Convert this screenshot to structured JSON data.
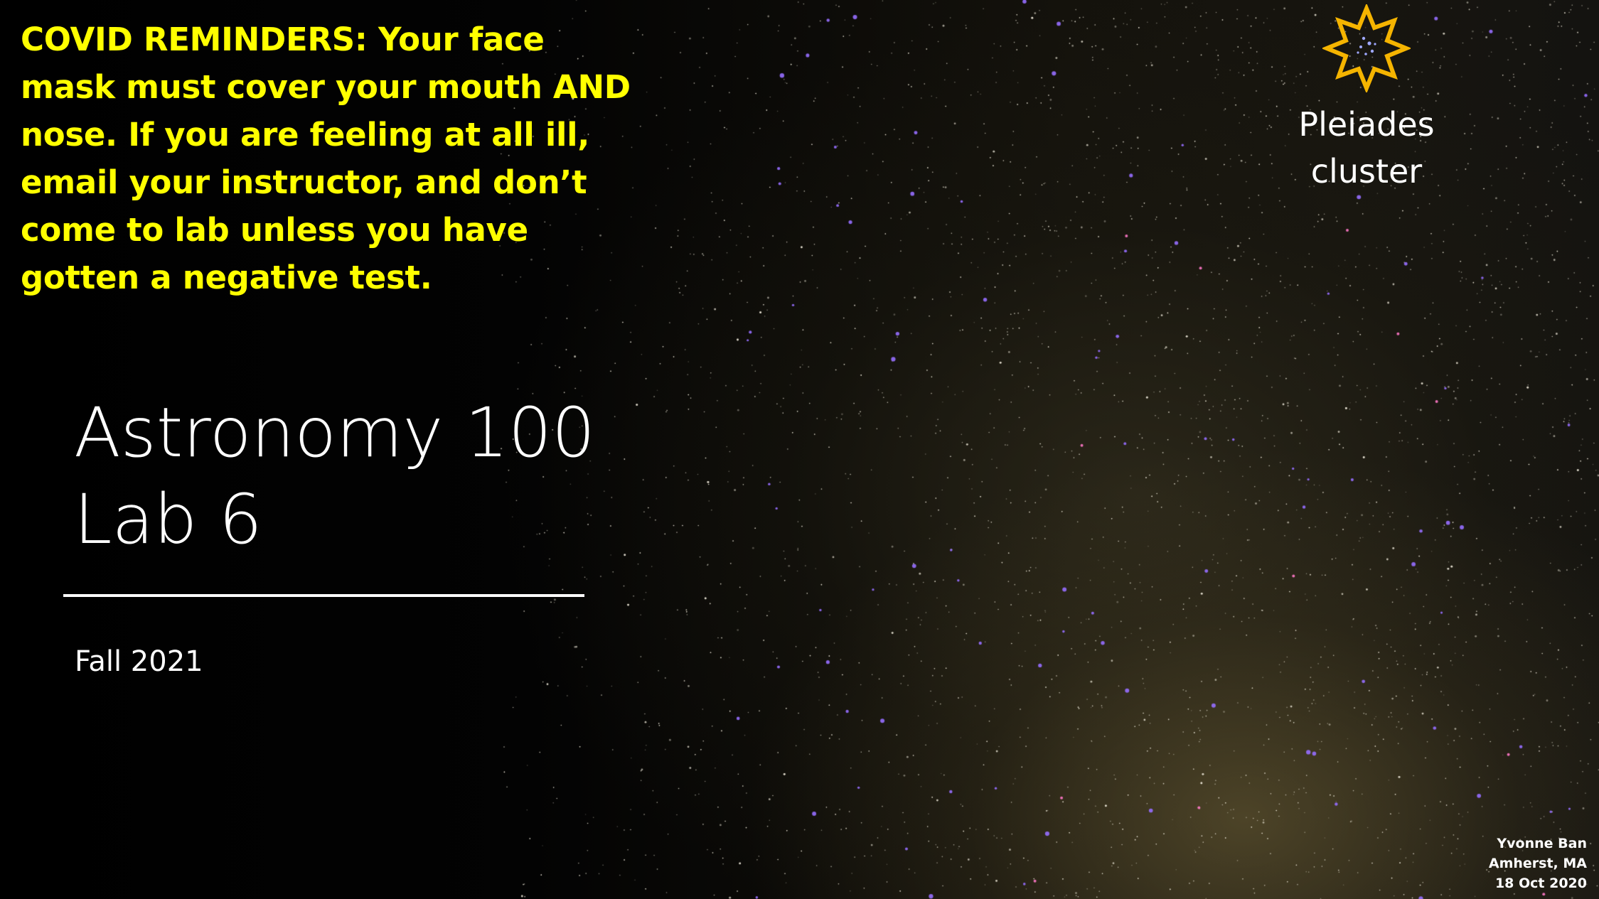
{
  "slide": {
    "covid_reminder": "COVID REMINDERS: Your face mask must cover your mouth AND nose. If you are feeling at all ill, email your instructor, and don’t come to lab unless you have gotten a negative test.",
    "title_line_1": "Astronomy 100",
    "title_line_2": "Lab 6",
    "subtitle": "Fall 2021",
    "annotation": {
      "line_1": "Pleiades",
      "line_2": "cluster",
      "marker_icon": "star-outline-icon",
      "marker_color": "#f5b400"
    },
    "credit": {
      "line_1": "Yvonne Ban",
      "line_2": "Amherst, MA",
      "line_3": "18 Oct 2020"
    }
  },
  "colors": {
    "reminder_text": "#ffff00",
    "title_text": "#ffffff",
    "background": "#000000"
  }
}
